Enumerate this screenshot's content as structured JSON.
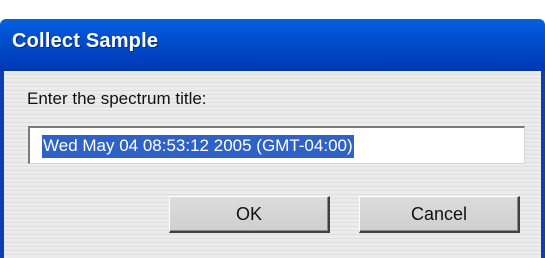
{
  "dialog": {
    "title": "Collect Sample",
    "prompt": "Enter the spectrum title:",
    "input_value": "Wed May 04 08:53:12 2005 (GMT-04:00)",
    "ok_label": "OK",
    "cancel_label": "Cancel"
  },
  "colors": {
    "titlebar": "#0049c5",
    "selection": "#2f62c6",
    "client_bg": "#ececec"
  }
}
